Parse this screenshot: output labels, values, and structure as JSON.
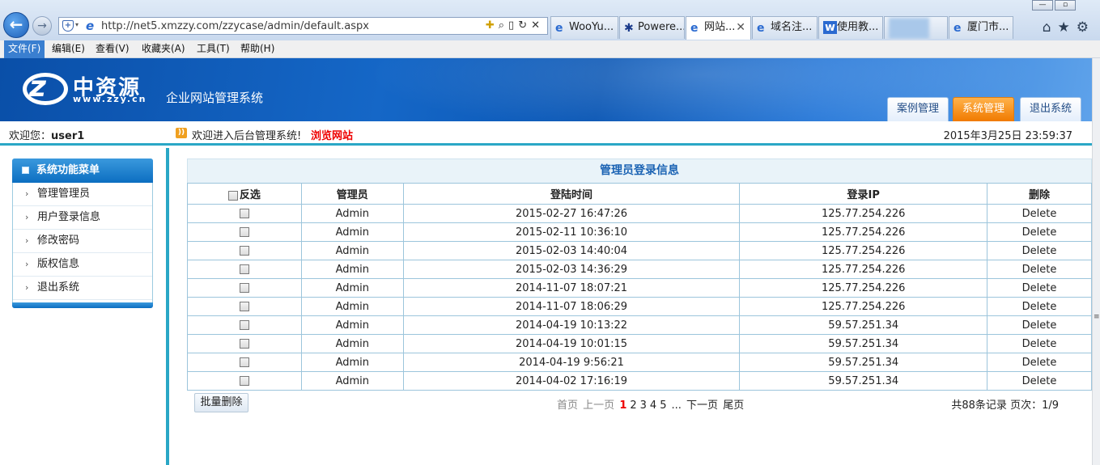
{
  "browser": {
    "url": "http://net5.xmzzy.com/zzycase/admin/default.aspx",
    "tabs": [
      {
        "label": "WooYu...",
        "icon": "ie-icon",
        "active": false
      },
      {
        "label": "Powere...",
        "icon": "paw-icon",
        "active": false
      },
      {
        "label": "网站...",
        "icon": "ie-icon",
        "active": true
      },
      {
        "label": "域名注...",
        "icon": "ie-icon",
        "active": false
      },
      {
        "label": "使用教...",
        "icon": "w-icon",
        "active": false
      },
      {
        "label": "",
        "icon": "blurred-icon",
        "active": false
      },
      {
        "label": "厦门市...",
        "icon": "ie-icon",
        "active": false
      }
    ],
    "menu": [
      "文件(F)",
      "编辑(E)",
      "查看(V)",
      "收藏夹(A)",
      "工具(T)",
      "帮助(H)"
    ]
  },
  "header": {
    "logo_name": "中资源",
    "logo_url": "www.zzy.cn",
    "system_title": "企业网站管理系统",
    "nav_tabs": [
      "案例管理",
      "系统管理",
      "退出系统"
    ],
    "active_tab": "系统管理"
  },
  "welcome": {
    "label": "欢迎您：",
    "user": "user1",
    "notice": "欢迎进入后台管理系统!",
    "browse_link": "浏览网站",
    "datetime": "2015年3月25日 23:59:37"
  },
  "sidebar": {
    "title": "系统功能菜单",
    "items": [
      "管理管理员",
      "用户登录信息",
      "修改密码",
      "版权信息",
      "退出系统"
    ]
  },
  "main": {
    "title": "管理员登录信息",
    "columns": [
      "反选",
      "管理员",
      "登陆时间",
      "登录IP",
      "删除"
    ],
    "rows": [
      {
        "admin": "Admin",
        "time": "2015-02-27 16:47:26",
        "ip": "125.77.254.226",
        "action": "Delete"
      },
      {
        "admin": "Admin",
        "time": "2015-02-11 10:36:10",
        "ip": "125.77.254.226",
        "action": "Delete"
      },
      {
        "admin": "Admin",
        "time": "2015-02-03 14:40:04",
        "ip": "125.77.254.226",
        "action": "Delete"
      },
      {
        "admin": "Admin",
        "time": "2015-02-03 14:36:29",
        "ip": "125.77.254.226",
        "action": "Delete"
      },
      {
        "admin": "Admin",
        "time": "2014-11-07 18:07:21",
        "ip": "125.77.254.226",
        "action": "Delete"
      },
      {
        "admin": "Admin",
        "time": "2014-11-07 18:06:29",
        "ip": "125.77.254.226",
        "action": "Delete"
      },
      {
        "admin": "Admin",
        "time": "2014-04-19 10:13:22",
        "ip": "59.57.251.34",
        "action": "Delete"
      },
      {
        "admin": "Admin",
        "time": "2014-04-19 10:01:15",
        "ip": "59.57.251.34",
        "action": "Delete"
      },
      {
        "admin": "Admin",
        "time": "2014-04-19 9:56:21",
        "ip": "59.57.251.34",
        "action": "Delete"
      },
      {
        "admin": "Admin",
        "time": "2014-04-02 17:16:19",
        "ip": "59.57.251.34",
        "action": "Delete"
      }
    ],
    "batch_delete": "批量删除",
    "pager": {
      "first": "首页",
      "prev": "上一页",
      "pages": [
        "1",
        "2",
        "3",
        "4",
        "5"
      ],
      "current": "1",
      "ellipsis": "...",
      "next": "下一页",
      "last": "尾页"
    },
    "record_info": "共88条记录  页次：1/9"
  },
  "colors": {
    "header_blue": "#0b57b5",
    "active_tab_orange": "#f07a00",
    "accent_teal": "#2aa7c6",
    "title_blue": "#1a62b3",
    "browse_link_red": "#ee0000"
  }
}
